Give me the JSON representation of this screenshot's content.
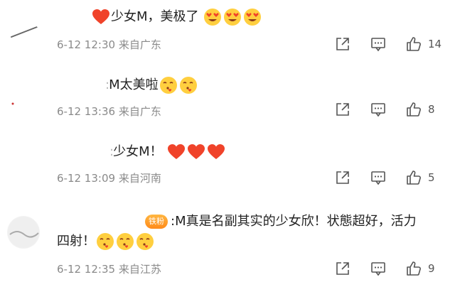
{
  "comments": [
    {
      "name_fragment": "",
      "text": "少女M，美极了",
      "date": "6-12 12:30",
      "location": "来自广东",
      "likes": "14"
    },
    {
      "name_fragment": ":",
      "text": "M太美啦",
      "date": "6-12 13:36",
      "location": "来自广东",
      "likes": "8"
    },
    {
      "name_fragment": ":",
      "text": "少女M！",
      "date": "6-12 13:09",
      "location": "来自河南",
      "likes": "5"
    },
    {
      "badge": "铁粉",
      "text": ":M真是名副其实的少女欣！状態超好，活力四射！",
      "date": "6-12 12:35",
      "location": "来自江苏",
      "likes": "9"
    }
  ],
  "icons": {
    "share": "share-icon",
    "comment": "comment-icon",
    "like": "thumbs-up-icon"
  }
}
